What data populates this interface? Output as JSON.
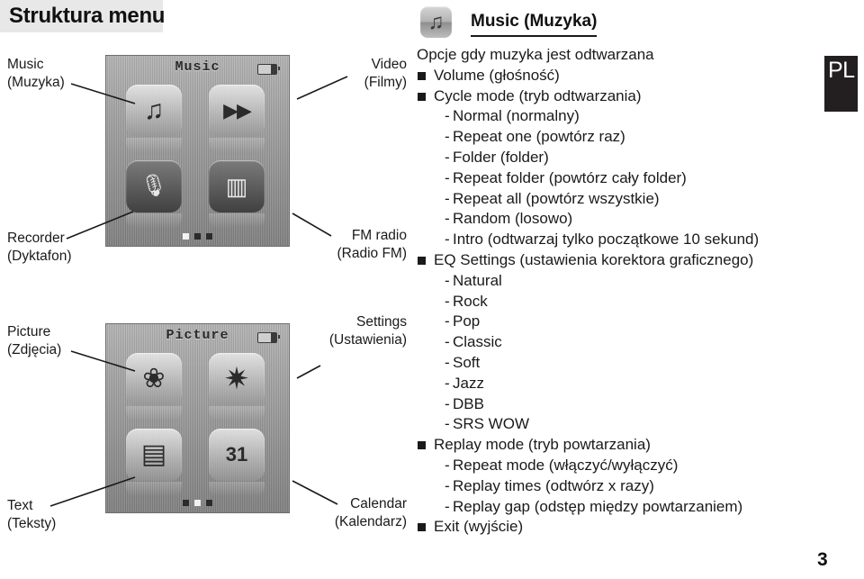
{
  "header": {
    "title": "Struktura menu"
  },
  "locale_badge": {
    "label": "PL"
  },
  "page_number": "3",
  "diagram": {
    "callouts": [
      {
        "id": "music",
        "line1": "Music",
        "line2": "(Muzyka)"
      },
      {
        "id": "recorder",
        "line1": "Recorder",
        "line2": "(Dyktafon)"
      },
      {
        "id": "picture",
        "line1": "Picture",
        "line2": "(Zdjęcia)"
      },
      {
        "id": "text",
        "line1": "Text",
        "line2": "(Teksty)"
      },
      {
        "id": "video",
        "line1": "Video",
        "line2": "(Filmy)"
      },
      {
        "id": "fmradio",
        "line1": "FM radio",
        "line2": "(Radio FM)"
      },
      {
        "id": "settings",
        "line1": "Settings",
        "line2": "(Ustawienia)"
      },
      {
        "id": "calendar",
        "line1": "Calendar",
        "line2": "(Kalendarz)"
      }
    ],
    "screens": [
      {
        "id": "screen-music",
        "title": "Music",
        "tiles": [
          {
            "name": "music-note-icon",
            "glyph": "♫"
          },
          {
            "name": "film-clapper-icon",
            "glyph": "▶▶"
          },
          {
            "name": "microphone-icon",
            "glyph": "🎙"
          },
          {
            "name": "radio-icon",
            "glyph": "▥"
          }
        ],
        "page_dots": [
          "active",
          "",
          ""
        ]
      },
      {
        "id": "screen-picture",
        "title": "Picture",
        "tiles": [
          {
            "name": "flower-photo-icon",
            "glyph": "❀"
          },
          {
            "name": "gear-settings-icon",
            "glyph": "✷"
          },
          {
            "name": "book-text-icon",
            "glyph": "▤"
          },
          {
            "name": "calendar-icon",
            "glyph": "31"
          }
        ],
        "page_dots": [
          "",
          "active",
          ""
        ]
      }
    ]
  },
  "section": {
    "icon_name": "music-note-icon",
    "icon_glyph": "♫",
    "title": "Music (Muzyka)",
    "intro": "Opcje gdy muzyka jest odtwarzana",
    "options": [
      {
        "level": "bullet",
        "text": "Volume (głośność)"
      },
      {
        "level": "bullet",
        "text": "Cycle mode (tryb odtwarzania)"
      },
      {
        "level": "sub",
        "text": "Normal (normalny)"
      },
      {
        "level": "sub",
        "text": "Repeat one (powtórz raz)"
      },
      {
        "level": "sub",
        "text": "Folder (folder)"
      },
      {
        "level": "sub",
        "text": "Repeat folder (powtórz cały folder)"
      },
      {
        "level": "sub",
        "text": "Repeat all (powtórz wszystkie)"
      },
      {
        "level": "sub",
        "text": "Random (losowo)"
      },
      {
        "level": "sub",
        "text": "Intro (odtwarzaj tylko początkowe 10 sekund)"
      },
      {
        "level": "bullet",
        "text": "EQ Settings (ustawienia korektora graficznego)"
      },
      {
        "level": "sub",
        "text": "Natural"
      },
      {
        "level": "sub",
        "text": "Rock"
      },
      {
        "level": "sub",
        "text": "Pop"
      },
      {
        "level": "sub",
        "text": "Classic"
      },
      {
        "level": "sub",
        "text": "Soft"
      },
      {
        "level": "sub",
        "text": "Jazz"
      },
      {
        "level": "sub",
        "text": "DBB"
      },
      {
        "level": "sub",
        "text": "SRS WOW"
      },
      {
        "level": "bullet",
        "text": "Replay mode (tryb powtarzania)"
      },
      {
        "level": "sub",
        "text": "Repeat mode (włączyć/wyłączyć)"
      },
      {
        "level": "sub",
        "text": "Replay times (odtwórz x razy)"
      },
      {
        "level": "sub",
        "text": "Replay gap (odstęp między powtarzaniem)"
      },
      {
        "level": "bullet",
        "text": "Exit (wyjście)"
      }
    ]
  },
  "colors": {
    "header_band": "#e8e8e8",
    "badge_bg": "#231f20",
    "text": "#1a1a1a"
  }
}
